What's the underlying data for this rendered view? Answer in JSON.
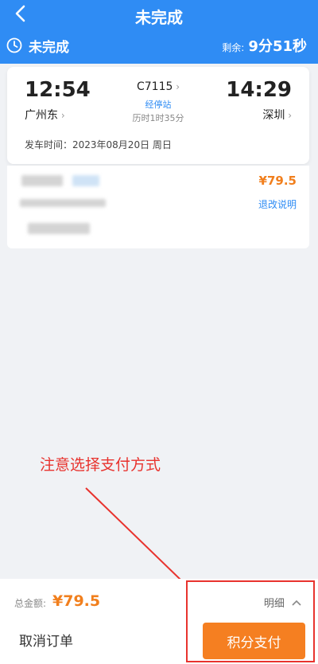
{
  "header": {
    "title": "未完成",
    "status_label": "未完成",
    "remaining_label": "剩余:",
    "remaining_time": "9分51秒"
  },
  "trip": {
    "departure_time": "12:54",
    "departure_station": "广州东",
    "train_number": "C7115",
    "stops_link": "经停站",
    "duration": "历时1时35分",
    "arrival_time": "14:29",
    "arrival_station": "深圳",
    "departure_info": "发车时间：2023年08月20日 周日"
  },
  "ticket": {
    "price": "¥79.5",
    "policy_link": "退改说明"
  },
  "annotation": {
    "tip": "注意选择支付方式",
    "color": "#e8332e"
  },
  "bottom": {
    "total_label": "总金额:",
    "total_amount": "¥79.5",
    "detail_label": "明细",
    "cancel_label": "取消订单",
    "pay_label": "积分支付"
  },
  "colors": {
    "brand": "#2f8cf4",
    "accent": "#f57f21",
    "price": "#f17f1d"
  },
  "icons": {
    "back": "chevron-left-icon",
    "clock": "clock-icon",
    "chevron": "chevron-right-icon",
    "detail": "chevron-up-icon"
  }
}
